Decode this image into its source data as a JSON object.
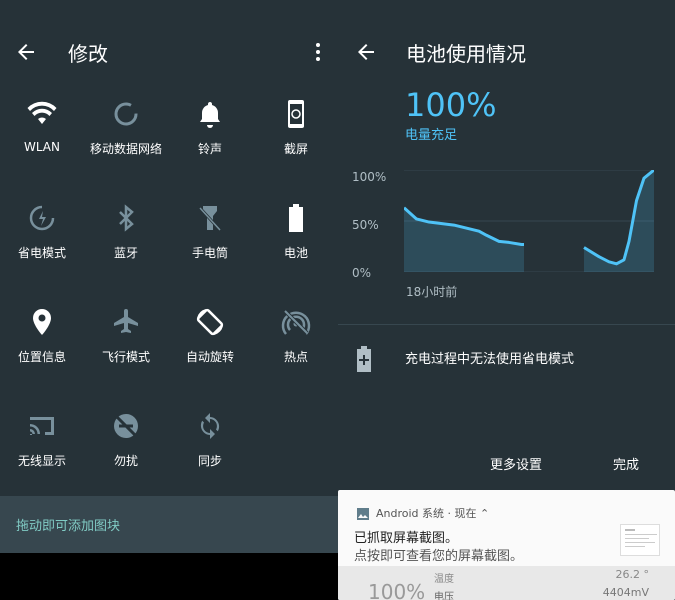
{
  "left": {
    "title": "修改",
    "tiles": [
      {
        "label": "WLAN",
        "icon": "wifi-icon"
      },
      {
        "label": "移动数据网络",
        "icon": "mobile-data-icon"
      },
      {
        "label": "铃声",
        "icon": "bell-icon"
      },
      {
        "label": "截屏",
        "icon": "screenshot-icon"
      },
      {
        "label": "省电模式",
        "icon": "battery-saver-icon"
      },
      {
        "label": "蓝牙",
        "icon": "bluetooth-icon"
      },
      {
        "label": "手电筒",
        "icon": "flashlight-icon"
      },
      {
        "label": "电池",
        "icon": "battery-icon"
      },
      {
        "label": "位置信息",
        "icon": "location-icon"
      },
      {
        "label": "飞行模式",
        "icon": "airplane-icon"
      },
      {
        "label": "自动旋转",
        "icon": "auto-rotate-icon"
      },
      {
        "label": "热点",
        "icon": "hotspot-icon"
      },
      {
        "label": "无线显示",
        "icon": "cast-icon"
      },
      {
        "label": "勿扰",
        "icon": "do-not-disturb-icon"
      },
      {
        "label": "同步",
        "icon": "sync-icon"
      }
    ],
    "hint": "拖动即可添加图块"
  },
  "right": {
    "title": "电池使用情况",
    "percent": "100%",
    "status": "电量充足",
    "yaxis": [
      "100%",
      "50%",
      "0%"
    ],
    "xlabel": "18小时前",
    "charge_note": "充电过程中无法使用省电模式",
    "more_settings": "更多设置",
    "done": "完成"
  },
  "chart_data": {
    "type": "area",
    "ylim": [
      0,
      100
    ],
    "yticks": [
      "100%",
      "50%",
      "0%"
    ],
    "xlabel": "18小时前",
    "series": [
      {
        "values": [
          [
            0,
            63
          ],
          [
            0.05,
            52
          ],
          [
            0.1,
            49
          ],
          [
            0.2,
            46
          ],
          [
            0.3,
            40
          ],
          [
            0.33,
            36
          ],
          [
            0.38,
            30
          ],
          [
            0.42,
            29
          ],
          [
            0.47,
            27
          ],
          [
            0.48,
            27
          ]
        ]
      },
      {
        "values": [
          [
            0.72,
            24
          ],
          [
            0.78,
            15
          ],
          [
            0.82,
            10
          ],
          [
            0.85,
            8
          ],
          [
            0.88,
            12
          ],
          [
            0.9,
            30
          ],
          [
            0.93,
            70
          ],
          [
            0.96,
            92
          ],
          [
            1.0,
            100
          ]
        ]
      }
    ],
    "color": "#4fc3f7"
  },
  "notification": {
    "app": "Android 系统 · 现在",
    "title": "已抓取屏幕截图。",
    "body": "点按即可查看您的屏幕截图。",
    "preview_percent": "100%",
    "preview_label1": "温度",
    "preview_label2": "电压",
    "preview_value1": "26.2 °",
    "preview_value2": "4404mV"
  }
}
